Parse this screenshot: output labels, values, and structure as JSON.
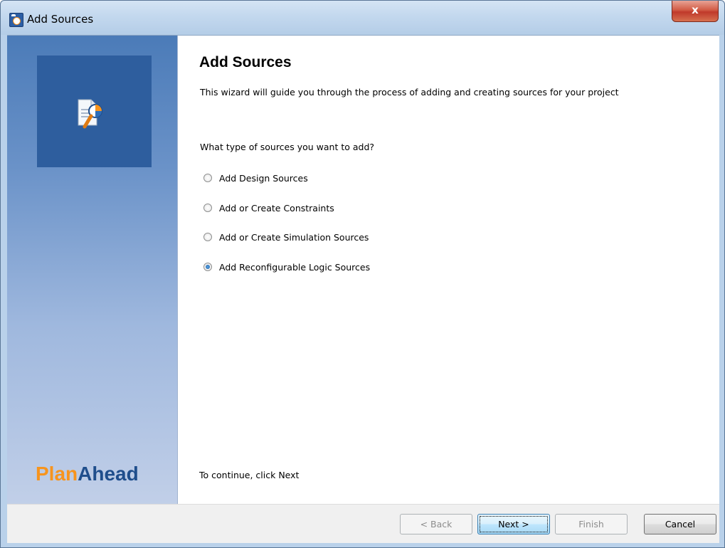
{
  "window": {
    "title": "Add Sources",
    "close_glyph": "x"
  },
  "side_panel": {
    "brand_plan": "Plan",
    "brand_ahead": "Ahead"
  },
  "wizard": {
    "title": "Add Sources",
    "description": "This wizard will guide you through the process of adding and creating sources for your project",
    "question": "What type of sources you want to add?",
    "options": [
      {
        "label": "Add Design Sources",
        "checked": false
      },
      {
        "label": "Add or Create Constraints",
        "checked": false
      },
      {
        "label": "Add or Create Simulation Sources",
        "checked": false
      },
      {
        "label": "Add Reconfigurable Logic Sources",
        "checked": true
      }
    ],
    "continue_text": "To continue, click Next"
  },
  "buttons": {
    "back": "< Back",
    "next": "Next >",
    "finish": "Finish",
    "cancel": "Cancel"
  },
  "colors": {
    "brand_plan": "#f7941d",
    "brand_ahead": "#1f4e8c",
    "close_button": "#c0392b"
  }
}
